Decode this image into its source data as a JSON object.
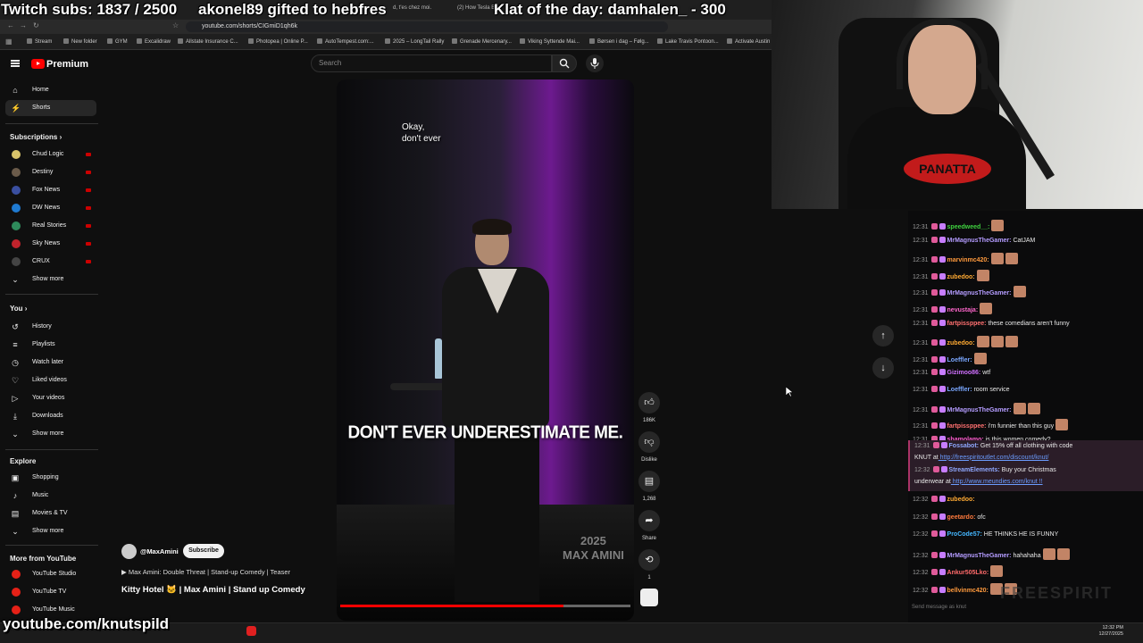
{
  "overlay": {
    "subs_goal": "Twitch subs: 1837 / 2500",
    "gift_msg": "akonel89 gifted to hebfres",
    "klat": "Klat of the day: damhalen_ - 300",
    "bottom_handle": "youtube.com/knutspild"
  },
  "browser": {
    "tabs": [
      "d, t'es chez moi.",
      "(2) How Tesla B..."
    ],
    "url": "youtube.com/shorts/CIGmiD1qh6k",
    "bookmarks": [
      "Stream",
      "New folder",
      "GYM",
      "Excalidraw",
      "Allstate Insurance C...",
      "Photopea | Online P...",
      "AutoTempest.com:...",
      "2025 – LongTail Rally",
      "Grenade Mercenary...",
      "Viking Syttende Mai...",
      "Børsen i dag – Følg...",
      "Lake Travis Pontoon...",
      "Activate Austin"
    ]
  },
  "yt": {
    "brand": "Premium",
    "search_placeholder": "Search",
    "nav": [
      {
        "label": "Home",
        "icon": "⌂"
      },
      {
        "label": "Shorts",
        "icon": "⚡"
      }
    ],
    "subs_head": "Subscriptions",
    "channels": [
      {
        "label": "Chud Logic",
        "color": "#d8c36a"
      },
      {
        "label": "Destiny",
        "color": "#6b5b4a"
      },
      {
        "label": "Fox News",
        "color": "#3a4fa0"
      },
      {
        "label": "DW News",
        "color": "#1f7ad1"
      },
      {
        "label": "Real Stories",
        "color": "#2e8a5b"
      },
      {
        "label": "Sky News",
        "color": "#c0232c"
      },
      {
        "label": "CRUX",
        "color": "#444444"
      }
    ],
    "show_more": "Show more",
    "you_head": "You",
    "you_items": [
      {
        "label": "History",
        "icon": "↺"
      },
      {
        "label": "Playlists",
        "icon": "≡"
      },
      {
        "label": "Watch later",
        "icon": "◷"
      },
      {
        "label": "Liked videos",
        "icon": "♡"
      },
      {
        "label": "Your videos",
        "icon": "▷"
      },
      {
        "label": "Downloads",
        "icon": "⤓"
      }
    ],
    "explore_head": "Explore",
    "explore_items": [
      {
        "label": "Shopping",
        "icon": "▣"
      },
      {
        "label": "Music",
        "icon": "♪"
      },
      {
        "label": "Movies & TV",
        "icon": "▤"
      }
    ],
    "more_head": "More from YouTube",
    "more_items": [
      "YouTube Studio",
      "YouTube TV",
      "YouTube Music"
    ],
    "video": {
      "small_sub_1": "Okay,",
      "small_sub_2": "don't ever",
      "caption": "DON'T EVER UNDERESTIMATE ME.",
      "wm_year": "2025",
      "wm_name": "MAX AMINI",
      "progress": 0.77
    },
    "meta": {
      "handle": "@MaxAmini",
      "subscribe": "Subscribe",
      "playlist": "▶ Max Amini: Double Threat | Stand-up Comedy | Teaser",
      "title": "Kitty Hotel 🐱 | Max Amini | Stand up Comedy"
    },
    "actions": {
      "likes": "186K",
      "dislike": "Dislike",
      "comments": "1,268",
      "share": "Share",
      "remix": "1"
    }
  },
  "webcam": {
    "shirt_logo": "PANATTA"
  },
  "chat": {
    "messages": [
      {
        "ts": "12:31",
        "user": "speedweed__:",
        "color": "#3fd13f",
        "text": "",
        "emotes": 1
      },
      {
        "ts": "12:31",
        "user": "MrMagnusTheGamer:",
        "color": "#b49cff",
        "text": "CatJAM",
        "emotes": 0
      },
      {
        "ts": "12:31",
        "user": "marvinmc420:",
        "color": "#ff9a3d",
        "text": "",
        "emotes": 2
      },
      {
        "ts": "12:31",
        "user": "zubedoo:",
        "color": "#ffaa33",
        "text": "",
        "emotes": 1
      },
      {
        "ts": "12:31",
        "user": "MrMagnusTheGamer:",
        "color": "#b49cff",
        "text": "",
        "emotes": 1
      },
      {
        "ts": "12:31",
        "user": "nevustaja:",
        "color": "#ff66cc",
        "text": "",
        "emotes": 1
      },
      {
        "ts": "12:31",
        "user": "fartpissppee:",
        "color": "#ff7070",
        "text": "these comedians aren't funny",
        "emotes": 0
      },
      {
        "ts": "12:31",
        "user": "zubedoo:",
        "color": "#ffaa33",
        "text": "",
        "emotes": 3
      },
      {
        "ts": "12:31",
        "user": "Loeffler:",
        "color": "#7aa7ff",
        "text": "",
        "emotes": 1
      },
      {
        "ts": "12:31",
        "user": "Gizimoo86:",
        "color": "#d070ff",
        "text": "wtf",
        "emotes": 0
      },
      {
        "ts": "12:31",
        "user": "Loeffler:",
        "color": "#7aa7ff",
        "text": "room service",
        "emotes": 0
      },
      {
        "ts": "12:31",
        "user": "MrMagnusTheGamer:",
        "color": "#b49cff",
        "text": "",
        "emotes": 2
      },
      {
        "ts": "12:31",
        "user": "fartpissppee:",
        "color": "#ff7070",
        "text": "i'm funnier than this guy",
        "emotes": 1
      },
      {
        "ts": "12:31",
        "user": "shamolamo:",
        "color": "#ff5ccf",
        "text": "is this women comedy?",
        "emotes": 0
      }
    ],
    "highlight": [
      {
        "ts": "12:31",
        "user": "Fossabot:",
        "color": "#8fa8ff",
        "text": "Get 15% off all clothing with code"
      },
      {
        "ts": "",
        "user": "",
        "color": "#ffffff",
        "text": "KNUT at",
        "link": "http://freespiritoutlet.com/discount/knut/"
      },
      {
        "ts": "12:32",
        "user": "StreamElements:",
        "color": "#8fa8ff",
        "text": "Buy your Christmas"
      },
      {
        "ts": "",
        "user": "",
        "color": "#ffffff",
        "text": "underwear at",
        "link": "http://www.meundies.com/knut !!"
      }
    ],
    "after": [
      {
        "ts": "12:32",
        "user": "zubedoo:",
        "color": "#ffaa33",
        "text": "",
        "emotes": 0
      },
      {
        "ts": "12:32",
        "user": "geetardo:",
        "color": "#ff7a3d",
        "text": "ofc",
        "emotes": 0
      },
      {
        "ts": "12:32",
        "user": "ProCode57:",
        "color": "#45b7ff",
        "text": "HE THINKS HE IS FUNNY",
        "emotes": 0
      },
      {
        "ts": "12:32",
        "user": "MrMagnusTheGamer:",
        "color": "#b49cff",
        "text": "hahahaha",
        "emotes": 2
      },
      {
        "ts": "12:32",
        "user": "Ankur505Lko:",
        "color": "#ff6a6a",
        "text": "",
        "emotes": 1
      },
      {
        "ts": "12:32",
        "user": "bellvinmc420:",
        "color": "#ff9a3d",
        "text": "",
        "emotes": 2
      }
    ],
    "input_placeholder": "Send message as knut",
    "watermark": "FREESPIRIT"
  },
  "taskbar": {
    "time": "12:32 PM",
    "date": "12/27/2025"
  }
}
